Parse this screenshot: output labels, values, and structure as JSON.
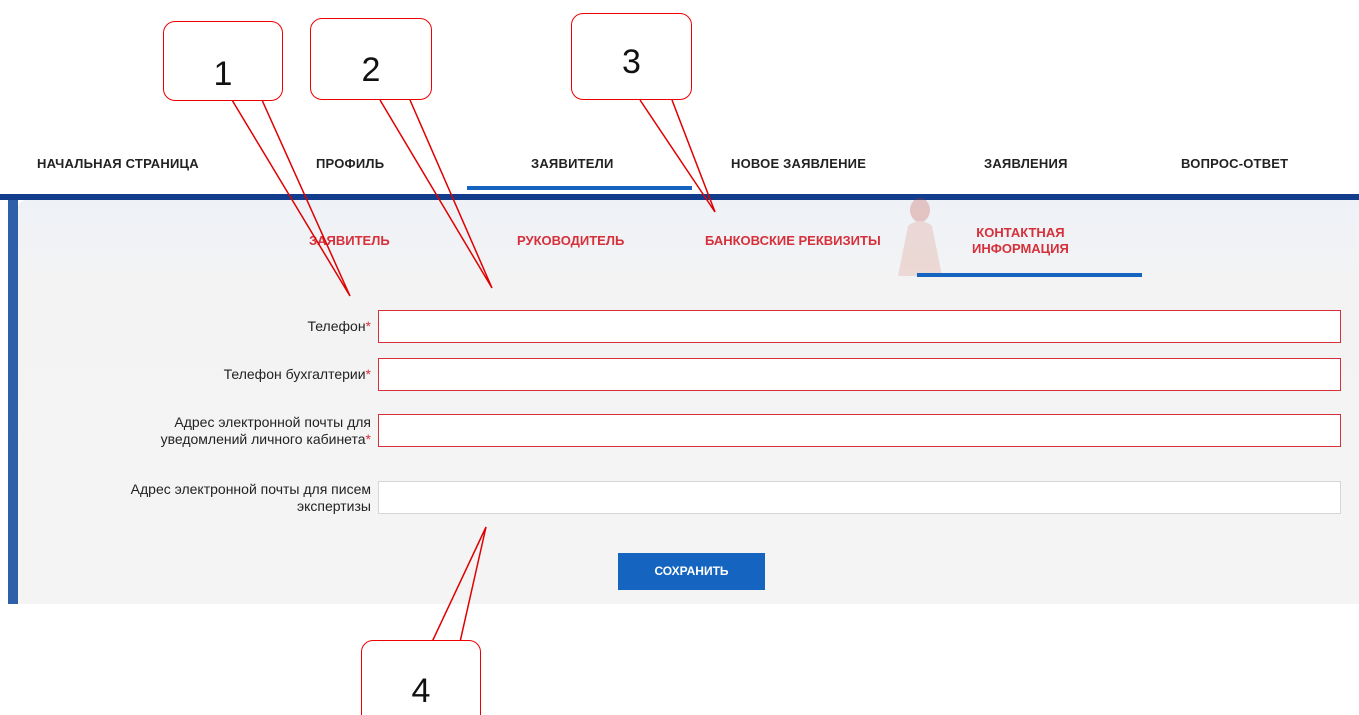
{
  "topnav": {
    "items": [
      "НАЧАЛЬНАЯ СТРАНИЦА",
      "ПРОФИЛЬ",
      "ЗАЯВИТЕЛИ",
      "НОВОЕ ЗАЯВЛЕНИЕ",
      "ЗАЯВЛЕНИЯ",
      "ВОПРОС-ОТВЕТ"
    ],
    "active": "ЗАЯВИТЕЛИ"
  },
  "subtabs": {
    "items": [
      "ЗАЯВИТЕЛЬ",
      "РУКОВОДИТЕЛЬ",
      "БАНКОВСКИЕ РЕКВИЗИТЫ",
      "КОНТАКТНАЯ ИНФОРМАЦИЯ"
    ],
    "active_line1": "КОНТАКТНАЯ",
    "active_line2": "ИНФОРМАЦИЯ"
  },
  "form": {
    "phone_label": "Телефон",
    "accounting_phone_label": "Телефон бухгалтерии",
    "notify_email_line1": "Адрес электронной почты для",
    "notify_email_line2": "уведомлений личного кабинета",
    "expert_email_line1": "Адрес электронной почты для писем",
    "expert_email_line2": "экспертизы",
    "required_mark": "*",
    "phone_value": "",
    "accounting_phone_value": "",
    "notify_email_value": "",
    "expert_email_value": ""
  },
  "actions": {
    "save_label": "СОХРАНИТЬ"
  },
  "callouts": [
    "1",
    "2",
    "3",
    "4"
  ],
  "colors": {
    "accent": "#1565c0",
    "required": "#d6303b",
    "callout_border": "#e00000"
  }
}
